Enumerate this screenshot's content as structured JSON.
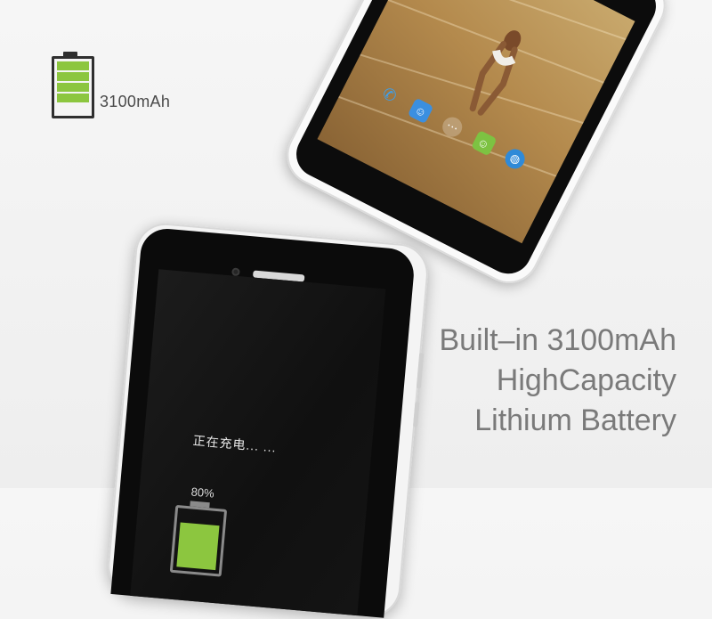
{
  "badge": {
    "capacity": "3100mAh",
    "battery_segments": 4,
    "color": "#8cc63f"
  },
  "tablet_bottom": {
    "charging_text": "正在充电... ...",
    "charge_percent_text": "80%",
    "charge_level": 0.8
  },
  "headline": {
    "line1": "Built–in 3100mAh",
    "line2": "HighCapacity",
    "line3": "Lithium Battery"
  }
}
